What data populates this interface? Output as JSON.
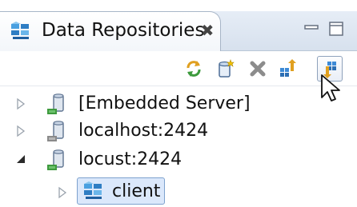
{
  "view": {
    "title": "Data Repositories",
    "close_glyph": "✖",
    "colors": {
      "tab_bg": "#ffffff",
      "tabbar_bg": "#d7e1ee",
      "selection": "#dbe8fb",
      "selection_border": "#7da2ce"
    }
  },
  "window_controls": {
    "minimize_icon": "minimize-icon",
    "maximize_icon": "maximize-icon"
  },
  "toolbar": {
    "buttons": [
      {
        "name": "refresh-button",
        "icon": "refresh-icon"
      },
      {
        "name": "new-repository-button",
        "icon": "new-repository-icon"
      },
      {
        "name": "delete-button",
        "icon": "delete-icon"
      },
      {
        "name": "import-button",
        "icon": "import-icon"
      },
      {
        "name": "synchronize-button",
        "icon": "sync-icon",
        "active": true
      }
    ]
  },
  "tree": {
    "items": [
      {
        "label": "[Embedded Server]",
        "expanded": false,
        "icon": "database-server-icon"
      },
      {
        "label": "localhost:2424",
        "expanded": false,
        "icon": "database-server-icon"
      },
      {
        "label": "locust:2424",
        "expanded": true,
        "icon": "database-server-icon",
        "children": [
          {
            "label": "client",
            "expanded": false,
            "selected": true,
            "icon": "repository-icon"
          }
        ]
      }
    ]
  }
}
